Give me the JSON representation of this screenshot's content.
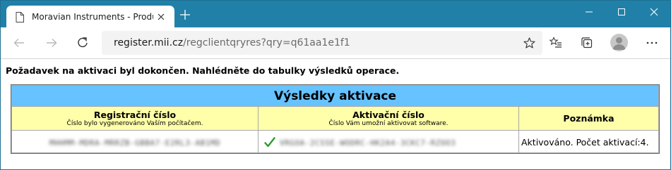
{
  "browser": {
    "tab_title": "Moravian Instruments - Product",
    "address": {
      "host": "register.mii.cz",
      "path": "/regclientqryres?qry=q61aa1e1f1"
    }
  },
  "page": {
    "message": "Požadavek na aktivaci byl dokončen. Nahlédněte do tabulky výsledků operace.",
    "table": {
      "caption": "Výsledky aktivace",
      "columns": [
        {
          "title": "Registrační číslo",
          "subtitle": "Číslo bylo vygenerováno Vaším počítačem."
        },
        {
          "title": "Aktivační číslo",
          "subtitle": "Číslo Vám umožní aktivovat software."
        },
        {
          "title": "Poznámka",
          "subtitle": ""
        }
      ],
      "row": {
        "registration_number": "MHHMM-MDRA-MRRZB-GBBA7-E2RL3-AB1MD",
        "activation_number": "VRGOA-2CSSE-WODRC-HK2A4-3CKC7-RZOO3",
        "note": "Aktivováno. Počet aktivací:4."
      }
    }
  },
  "colors": {
    "titlebar": "#2080a8",
    "table_caption_bg": "#66c3ff",
    "table_header_bg": "#ffffaa",
    "check": "#2e9a2e"
  }
}
